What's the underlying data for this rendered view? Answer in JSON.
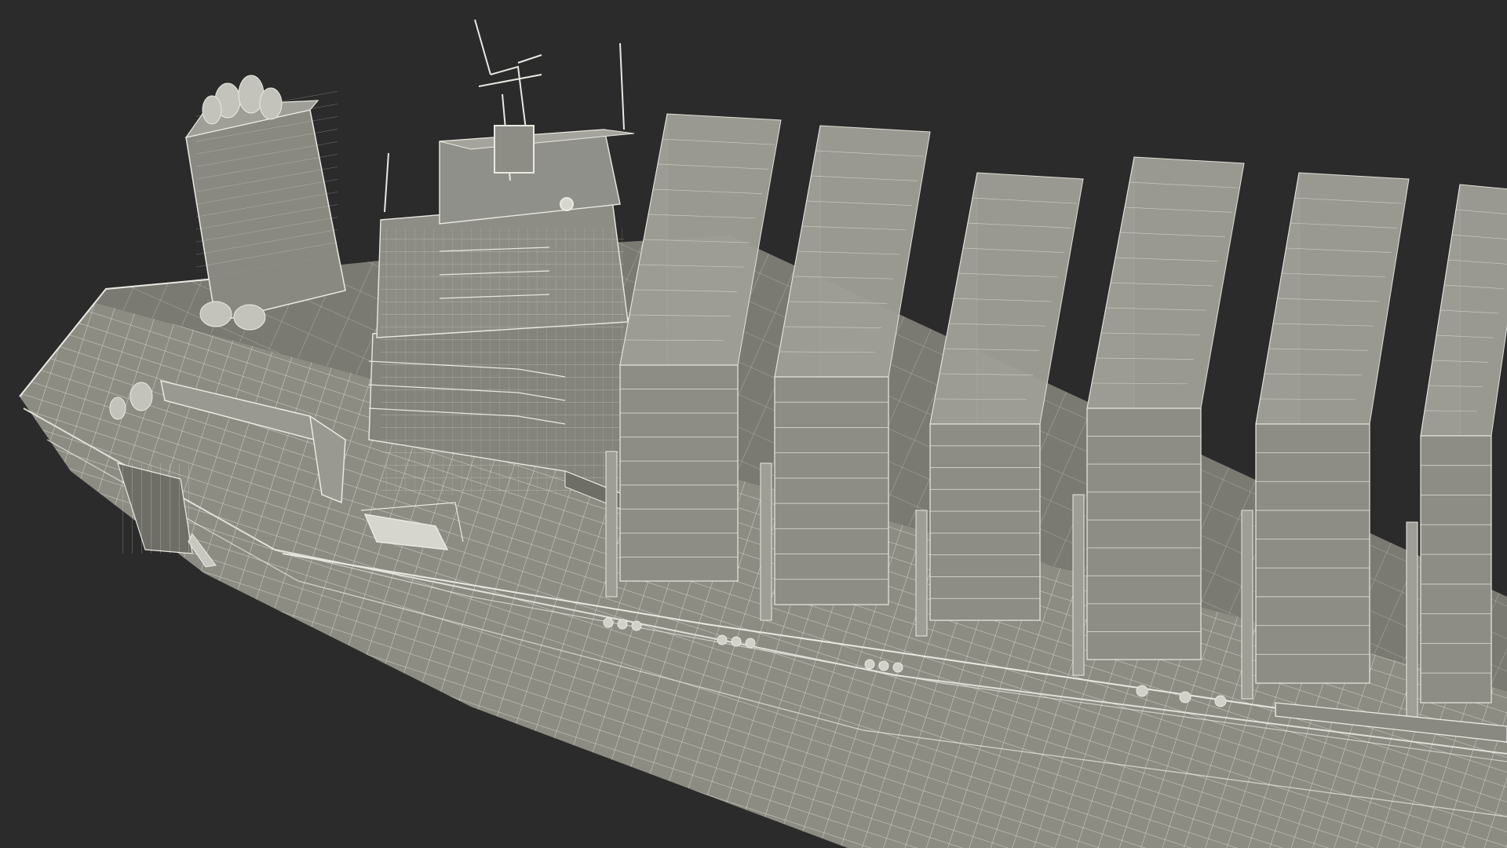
{
  "scene": {
    "subject": "container-ship-wireframe-render",
    "colors": {
      "background": "#2b2b2b",
      "hull": "#8d8c83",
      "hull_dark": "#6f6e66",
      "deck": "#7b7a72",
      "container_face": "#8e8d85",
      "container_side": "#6a6962",
      "container_top": "#a09f97",
      "wire": "#e9e8e2",
      "superstructure": "#85847c",
      "funnel": "#8a8981"
    },
    "container_stacks": 6,
    "container_tiers": 9,
    "lifeboats": 1,
    "visible_text": []
  }
}
